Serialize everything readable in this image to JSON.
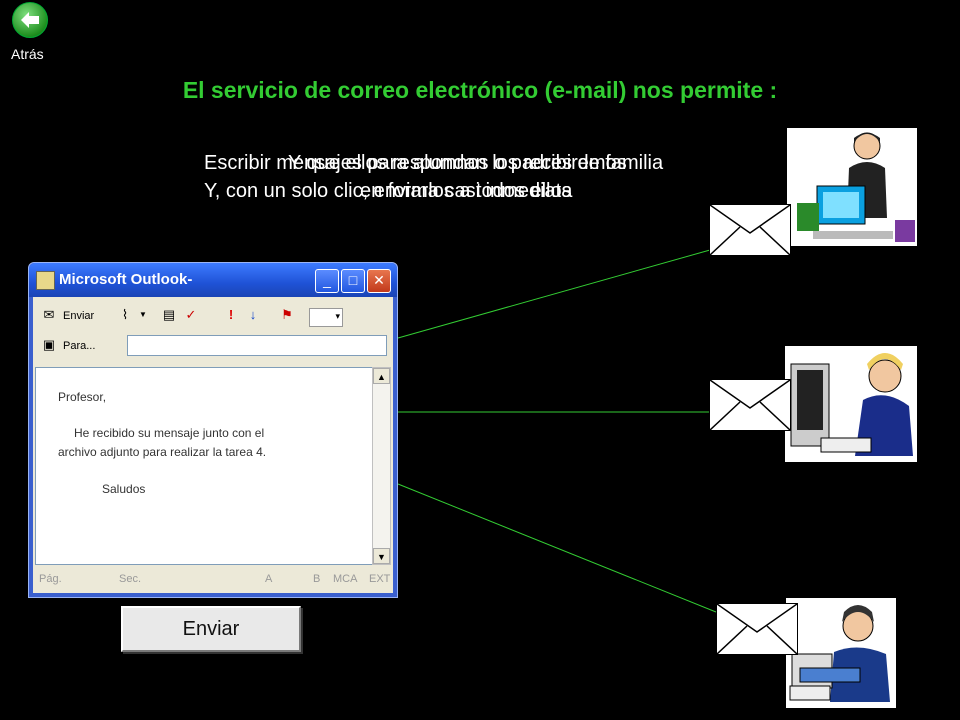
{
  "nav": {
    "back_label": "Atrás"
  },
  "slide": {
    "title": "El servicio de correo electrónico (e-mail) nos permite :",
    "overlap_lines": [
      "Escribir mensajes para alumnos o padres de familia",
      "Y que ellos respondan los recibiremos",
      "Y, con un solo clic, enviarlos a todos ellos",
      "en forma casi inmediata"
    ]
  },
  "outlook": {
    "window_title": "Microsoft Outlook-",
    "toolbar_send_label": "Enviar",
    "to_label": "Para...",
    "message": {
      "greeting": "Profesor,",
      "line1": "He recibido su mensaje junto con el",
      "line2": "archivo adjunto para realizar la tarea 4.",
      "closing": "Saludos"
    },
    "status": {
      "page": "Pág.",
      "section": "Sec.",
      "a": "A",
      "b": "B",
      "mca": "MCA",
      "ext": "EXT"
    }
  },
  "send_button_label": "Enviar",
  "icons": [
    "back-arrow-icon",
    "envelope-icon",
    "person-teacher-icon",
    "person-student-icon",
    "person-office-icon"
  ],
  "colors": {
    "title": "#33cc33",
    "lines": "#33cc33",
    "background": "#000000"
  }
}
